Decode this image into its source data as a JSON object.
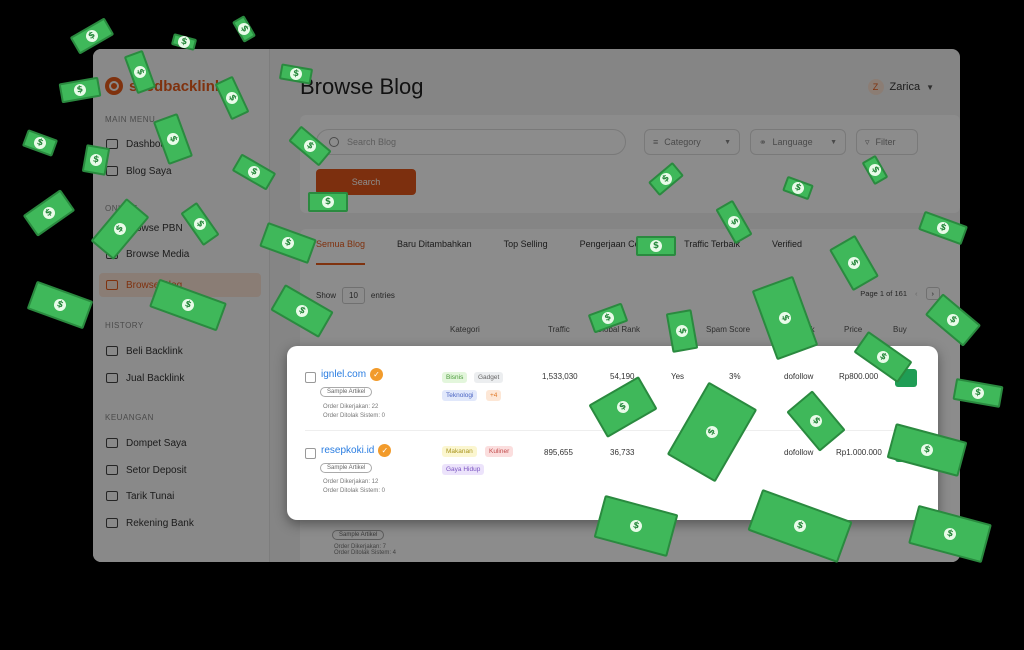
{
  "brand": "seedbacklink",
  "sidebar": {
    "main_menu": "MAIN MENU",
    "items_main": [
      "Dashboard",
      "Blog Saya"
    ],
    "online": "ONLINE",
    "items_online": [
      "Browse PBN",
      "Browse Media",
      "Browse Blog"
    ],
    "history": "HISTORY",
    "items_history": [
      "Beli Backlink",
      "Jual Backlink"
    ],
    "keuangan": "KEUANGAN",
    "items_keuangan": [
      "Dompet Saya",
      "Setor Deposit",
      "Tarik Tunai",
      "Rekening Bank"
    ]
  },
  "header": {
    "title": "Browse Blog",
    "user_initial": "Z",
    "user_name": "Zarica"
  },
  "filters": {
    "search_placeholder": "Search Blog",
    "category": "Category",
    "language": "Language",
    "filter": "Filter",
    "search_button": "Search"
  },
  "tabs": [
    "Semua Blog",
    "Baru Ditambahkan",
    "Top Selling",
    "Pengerjaan Cepat",
    "Traffic Terbaik",
    "Verified"
  ],
  "table": {
    "show_prefix": "Show",
    "show_value": "10",
    "show_suffix": "entries",
    "page_info": "Page 1 of 161",
    "columns": [
      "Kategori",
      "Traffic",
      "Global Rank",
      "Spam Score",
      "Link",
      "Price",
      "Buy"
    ]
  },
  "rows": [
    {
      "site": "ignlel.com",
      "sample": "Sample Artikel",
      "order_done": "Order Dikerjakan: 22",
      "order_rejected": "Order Ditolak Sistem: 0",
      "tags": [
        "Bisnis",
        "Gadget",
        "Teknologi",
        "+4"
      ],
      "traffic": "1,533,030",
      "rank": "54,190",
      "flag": "Yes",
      "spam": "3%",
      "link": "dofollow",
      "price": "Rp800.000"
    },
    {
      "site": "resepkoki.id",
      "sample": "Sample Artikel",
      "order_done": "Order Dikerjakan: 12",
      "order_rejected": "Order Ditolak Sistem: 0",
      "tags": [
        "Makanan",
        "Kuliner",
        "Gaya Hidup"
      ],
      "traffic": "895,655",
      "rank": "36,733",
      "flag": "",
      "spam": "",
      "link": "dofollow",
      "price": "Rp1.000.000"
    }
  ],
  "bg_row": {
    "sample": "Sample Artikel",
    "order_done": "Order Dikerjakan: 7",
    "order_rejected": "Order Ditolak Sistem: 4"
  },
  "bill_symbol": "$"
}
